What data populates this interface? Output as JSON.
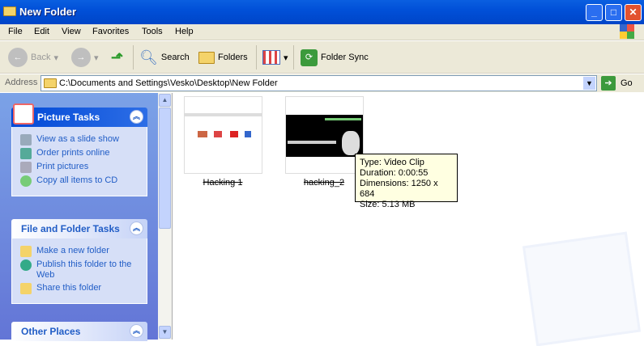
{
  "window": {
    "title": "New Folder"
  },
  "menu": [
    "File",
    "Edit",
    "View",
    "Favorites",
    "Tools",
    "Help"
  ],
  "toolbar": {
    "back": "Back",
    "search": "Search",
    "folders": "Folders",
    "folder_sync": "Folder Sync"
  },
  "address": {
    "label": "Address",
    "value": "C:\\Documents and Settings\\Vesko\\Desktop\\New Folder",
    "go": "Go"
  },
  "picture_tasks": {
    "title": "Picture Tasks",
    "items": [
      "View as a slide show",
      "Order prints online",
      "Print pictures",
      "Copy all items to CD"
    ]
  },
  "file_tasks": {
    "title": "File and Folder Tasks",
    "items": [
      "Make a new folder",
      "Publish this folder to the Web",
      "Share this folder"
    ]
  },
  "other_places": {
    "title": "Other Places"
  },
  "files": [
    {
      "name": "Hacking 1"
    },
    {
      "name": "hacking_2"
    }
  ],
  "tooltip": {
    "type": "Type: Video Clip",
    "duration": "Duration: 0:00:55",
    "dimensions": "Dimensions: 1250 x 684",
    "size": "Size: 5.13 MB"
  }
}
